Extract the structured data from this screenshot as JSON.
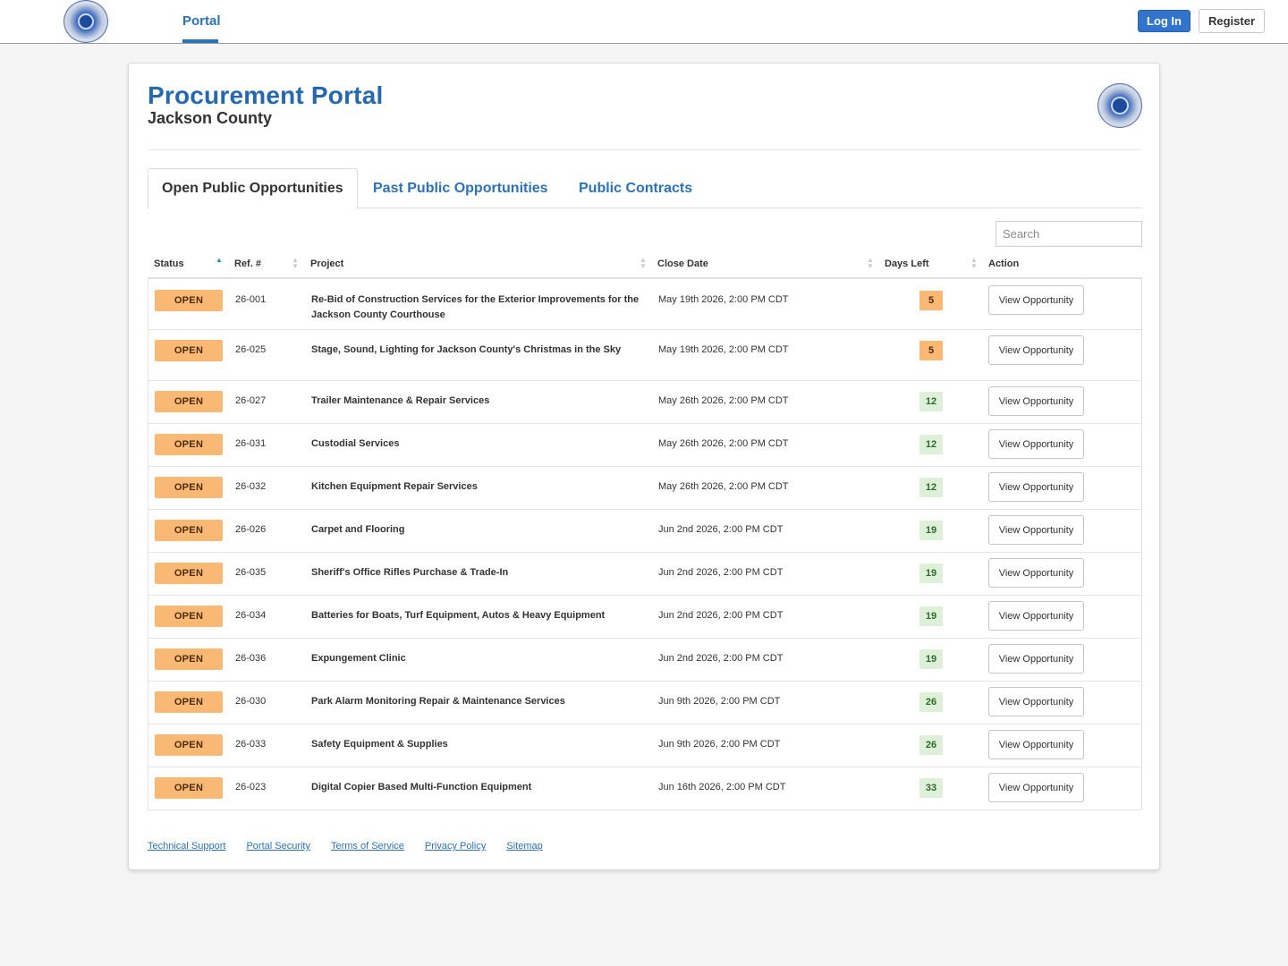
{
  "nav": {
    "portal": "Portal",
    "login": "Log In",
    "register": "Register"
  },
  "header": {
    "title": "Procurement Portal",
    "subtitle": "Jackson County"
  },
  "tabs": [
    "Open Public Opportunities",
    "Past Public Opportunities",
    "Public Contracts"
  ],
  "search": {
    "placeholder": "Search"
  },
  "columns": [
    "Status",
    "Ref. #",
    "Project",
    "Close Date",
    "Days Left",
    "Action"
  ],
  "rows": [
    {
      "status": "OPEN",
      "ref": "26-001",
      "project": "Re-Bid of Construction Services for the Exterior Improvements for the Jackson County Courthouse",
      "close": "May 19th 2026, 2:00 PM CDT",
      "days": "5",
      "action": "View Opportunity"
    },
    {
      "status": "OPEN",
      "ref": "26-025",
      "project": "Stage, Sound, Lighting for Jackson County's Christmas in the Sky",
      "close": "May 19th 2026, 2:00 PM CDT",
      "days": "5",
      "action": "View Opportunity"
    },
    {
      "status": "OPEN",
      "ref": "26-027",
      "project": "Trailer Maintenance & Repair Services",
      "close": "May 26th 2026, 2:00 PM CDT",
      "days": "12",
      "action": "View Opportunity"
    },
    {
      "status": "OPEN",
      "ref": "26-031",
      "project": "Custodial Services",
      "close": "May 26th 2026, 2:00 PM CDT",
      "days": "12",
      "action": "View Opportunity"
    },
    {
      "status": "OPEN",
      "ref": "26-032",
      "project": "Kitchen Equipment Repair Services",
      "close": "May 26th 2026, 2:00 PM CDT",
      "days": "12",
      "action": "View Opportunity"
    },
    {
      "status": "OPEN",
      "ref": "26-026",
      "project": "Carpet and Flooring",
      "close": "Jun 2nd 2026, 2:00 PM CDT",
      "days": "19",
      "action": "View Opportunity"
    },
    {
      "status": "OPEN",
      "ref": "26-035",
      "project": "Sheriff's Office Rifles Purchase & Trade-In",
      "close": "Jun 2nd 2026, 2:00 PM CDT",
      "days": "19",
      "action": "View Opportunity"
    },
    {
      "status": "OPEN",
      "ref": "26-034",
      "project": "Batteries for Boats, Turf Equipment, Autos & Heavy Equipment",
      "close": "Jun 2nd 2026, 2:00 PM CDT",
      "days": "19",
      "action": "View Opportunity"
    },
    {
      "status": "OPEN",
      "ref": "26-036",
      "project": "Expungement Clinic",
      "close": "Jun 2nd 2026, 2:00 PM CDT",
      "days": "19",
      "action": "View Opportunity"
    },
    {
      "status": "OPEN",
      "ref": "26-030",
      "project": "Park Alarm Monitoring Repair & Maintenance Services",
      "close": "Jun 9th 2026, 2:00 PM CDT",
      "days": "26",
      "action": "View Opportunity"
    },
    {
      "status": "OPEN",
      "ref": "26-033",
      "project": "Safety Equipment & Supplies",
      "close": "Jun 9th 2026, 2:00 PM CDT",
      "days": "26",
      "action": "View Opportunity"
    },
    {
      "status": "OPEN",
      "ref": "26-023",
      "project": "Digital Copier Based Multi-Function Equipment",
      "close": "Jun 16th 2026, 2:00 PM CDT",
      "days": "33",
      "action": "View Opportunity"
    }
  ],
  "footer": [
    "Technical Support",
    "Portal Security",
    "Terms of Service",
    "Privacy Policy",
    "Sitemap"
  ],
  "colors": {
    "primary": "#2b72b8",
    "open_badge": "#f9b873",
    "days_ok": "#dff0d8",
    "login_button": "#3273cc"
  }
}
